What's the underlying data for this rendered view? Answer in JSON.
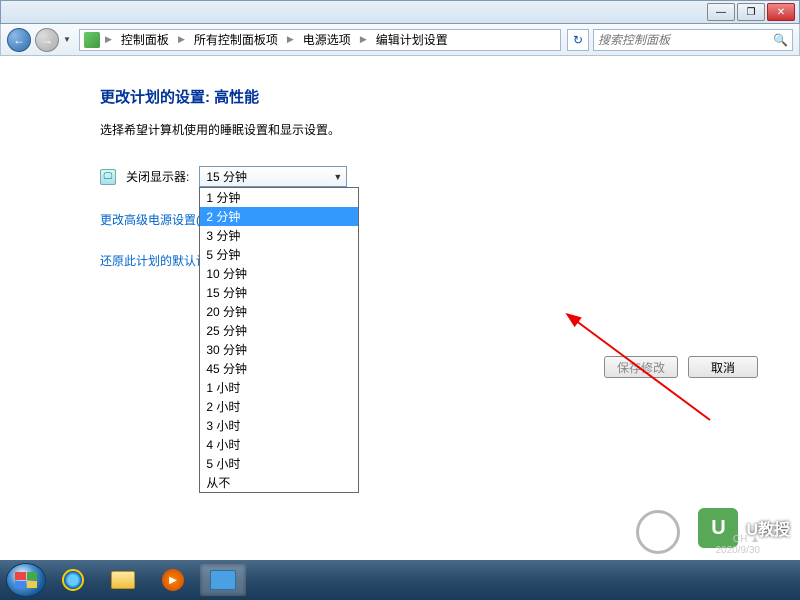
{
  "titlebar": {
    "min": "—",
    "max": "❐",
    "close": "✕"
  },
  "nav": {
    "back": "←",
    "fwd": "→",
    "refresh": "↻"
  },
  "breadcrumb": {
    "items": [
      "控制面板",
      "所有控制面板项",
      "电源选项",
      "编辑计划设置"
    ],
    "sep": "▶"
  },
  "search": {
    "placeholder": "搜索控制面板",
    "icon": "🔍"
  },
  "page": {
    "title": "更改计划的设置: 高性能",
    "desc": "选择希望计算机使用的睡眠设置和显示设置。"
  },
  "setting": {
    "icon": "🖵",
    "label": "关闭显示器:",
    "selected": "15 分钟",
    "arrow": "▼"
  },
  "dropdown": {
    "items": [
      "1 分钟",
      "2 分钟",
      "3 分钟",
      "5 分钟",
      "10 分钟",
      "15 分钟",
      "20 分钟",
      "25 分钟",
      "30 分钟",
      "45 分钟",
      "1 小时",
      "2 小时",
      "3 小时",
      "4 小时",
      "5 小时",
      "从不"
    ],
    "highlighted_index": 1
  },
  "links": {
    "advanced": "更改高级电源设置(C",
    "restore": "还原此计划的默认设"
  },
  "buttons": {
    "save": "保存修改",
    "cancel": "取消"
  },
  "taskbar": {
    "wmp_glyph": "▶"
  },
  "watermark": {
    "badge": "U",
    "text": "U教授"
  },
  "clock": {
    "line1": "CH ▲",
    "line2": "2020/9/30"
  }
}
